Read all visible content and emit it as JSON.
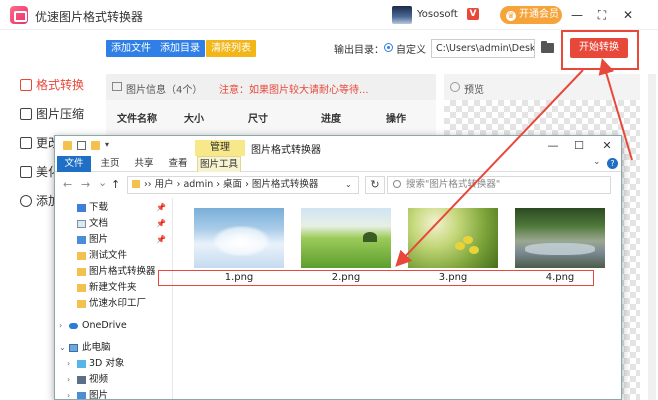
{
  "app": {
    "title": "优速图片格式转换器",
    "user_name": "Yososoft",
    "vip_mark": "V",
    "vip_label": "开通会员",
    "min_icon": "—",
    "max_icon": "⛶",
    "close_icon": "✕"
  },
  "toolbar": {
    "add_file": "添加文件",
    "add_dir": "添加目录",
    "clear_list": "清除列表",
    "output_label": "输出目录：",
    "custom_option": "自定义",
    "output_path": "C:\\Users\\admin\\Deskto",
    "start_button": "开始转换"
  },
  "nav": {
    "items": [
      {
        "label": "格式转换",
        "active": true
      },
      {
        "label": "图片压缩"
      },
      {
        "label": "更改"
      },
      {
        "label": "美化"
      },
      {
        "label": "添加"
      }
    ]
  },
  "info_panel": {
    "title": "图片信息（4个）",
    "tip": "注意：如果图片较大请耐心等待...",
    "columns": [
      "文件名称",
      "大小",
      "尺寸",
      "进度",
      "操作"
    ]
  },
  "preview": {
    "title": "预览"
  },
  "explorer": {
    "qa_arrow": "▾",
    "manage_tab": "管理",
    "title": "图片格式转换器",
    "minimize": "—",
    "maximize": "☐",
    "close": "✕",
    "ribbon": {
      "file": "文件",
      "home": "主页",
      "share": "共享",
      "view": "查看",
      "picture_tools": "图片工具"
    },
    "address": {
      "back": "←",
      "forward": "→",
      "up_list": "⌄",
      "up": "↑",
      "path": "›› 用户 › admin › 桌面 › 图片格式转换器",
      "dropdown": "⌄",
      "refresh": "↻"
    },
    "search_placeholder": "搜索\"图片格式转换器\"",
    "sidebar": [
      {
        "label": "下载",
        "pinned": true,
        "icon": "download-icon"
      },
      {
        "label": "文档",
        "pinned": true,
        "icon": "document-icon"
      },
      {
        "label": "图片",
        "pinned": true,
        "icon": "pictures-icon"
      },
      {
        "label": "测试文件",
        "icon": "folder-icon"
      },
      {
        "label": "图片格式转换器",
        "icon": "folder-icon"
      },
      {
        "label": "新建文件夹",
        "icon": "folder-icon"
      },
      {
        "label": "优速水印工厂",
        "icon": "folder-icon"
      },
      {
        "label": "OneDrive",
        "icon": "cloud-icon"
      },
      {
        "label": "此电脑",
        "icon": "computer-icon"
      },
      {
        "label": "3D 对象",
        "icon": "cube-icon"
      },
      {
        "label": "视频",
        "icon": "video-icon"
      },
      {
        "label": "图片",
        "icon": "pictures-icon"
      }
    ],
    "pin_glyph": "📌",
    "files": [
      "1.png",
      "2.png",
      "3.png",
      "4.png"
    ]
  },
  "colors": {
    "accent_red": "#e8483a",
    "blue": "#2f7fe6",
    "yellow": "#f2b619",
    "vip_orange": "#f6a33a"
  }
}
